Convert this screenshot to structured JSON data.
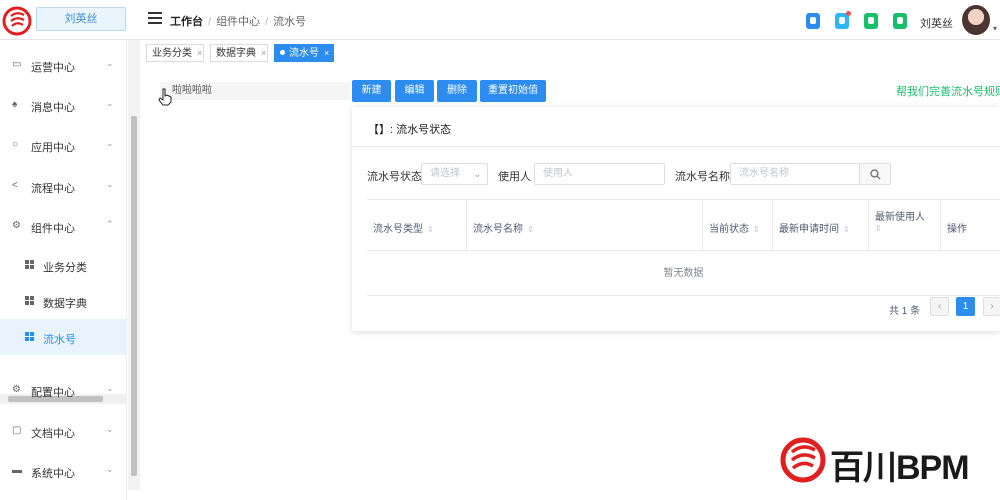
{
  "header": {
    "user_box": "刘英丝",
    "breadcrumb": {
      "root": "工作台",
      "level1": "组件中心",
      "level2": "流水号"
    },
    "user_name": "刘英丝",
    "icon_colors": [
      "#2d8cf0",
      "#2db7f5",
      "#19be6b",
      "#19be6b"
    ]
  },
  "sidebar": {
    "items": [
      {
        "label": "运营中心",
        "icon": "monitor-icon",
        "arrow": "⌄"
      },
      {
        "label": "消息中心",
        "icon": "bell-icon",
        "arrow": "⌄"
      },
      {
        "label": "应用中心",
        "icon": "app-icon",
        "arrow": "⌄"
      },
      {
        "label": "流程中心",
        "icon": "share-icon",
        "arrow": "⌄"
      },
      {
        "label": "组件中心",
        "icon": "gear-icon",
        "arrow": "⌃"
      }
    ],
    "sub_items": [
      {
        "label": "业务分类"
      },
      {
        "label": "数据字典"
      },
      {
        "label": "流水号"
      }
    ],
    "lower_items": [
      {
        "label": "配置中心",
        "icon": "gear-icon",
        "arrow": "⌄"
      },
      {
        "label": "文档中心",
        "icon": "folder-icon",
        "arrow": "⌄"
      },
      {
        "label": "系统中心",
        "icon": "monitor-icon",
        "arrow": "⌄"
      }
    ]
  },
  "tabs": [
    {
      "label": "业务分类"
    },
    {
      "label": "数据字典"
    },
    {
      "label": "流水号"
    }
  ],
  "tree": {
    "node": "啦啦啦啦"
  },
  "toolbar": {
    "new": "新建",
    "edit": "编辑",
    "delete": "删除",
    "reset": "重置初始值"
  },
  "help_link": "帮我们完善流水号规则",
  "panel": {
    "title": "【】: 流水号状态",
    "filters": {
      "status_label": "流水号状态",
      "status_placeholder": "请选择",
      "user_label": "使用人",
      "user_placeholder": "使用人",
      "name_label": "流水号名称",
      "name_placeholder": "流水号名称"
    },
    "columns": [
      "流水号类型",
      "流水号名称",
      "当前状态",
      "最新申请时间",
      "最新使用人",
      "操作"
    ],
    "empty_text": "暂无数据",
    "total": "共 1 条",
    "page": "1"
  },
  "watermark": {
    "text": "百川BPM"
  }
}
